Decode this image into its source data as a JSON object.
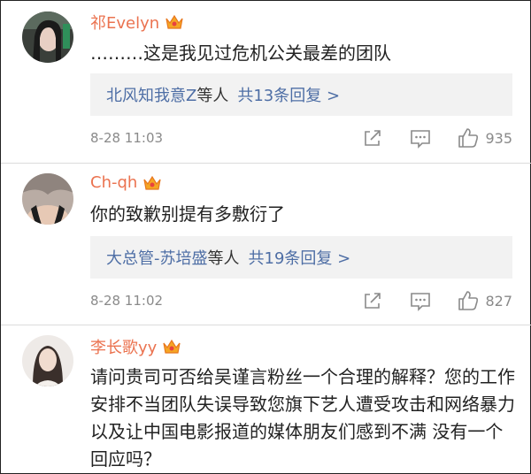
{
  "colors": {
    "username": "#eb7350",
    "link": "#4e6ea5",
    "reply_bg": "#f2f2f2",
    "meta": "#8a8a8a"
  },
  "comments": [
    {
      "username": "祁Evelyn",
      "text": "………这是我见过危机公关最差的团队",
      "reply_names": "北风知我意Z",
      "reply_mid": "等人",
      "reply_count": "共13条回复 >",
      "time": "8-28 11:03",
      "likes": "935"
    },
    {
      "username": "Ch-qh",
      "text": "你的致歉别提有多敷衍了",
      "reply_names": "大总管-苏培盛",
      "reply_mid": "等人",
      "reply_count": "共19条回复 >",
      "time": "8-28 11:02",
      "likes": "827"
    },
    {
      "username": "李长歌yy",
      "text": "请问贵司可否给吴谨言粉丝一个合理的解释？您的工作安排不当团队失误导致您旗下艺人遭受攻击和网络暴力 以及让中国电影报道的媒体朋友们感到不满 没有一个回应吗？"
    }
  ]
}
